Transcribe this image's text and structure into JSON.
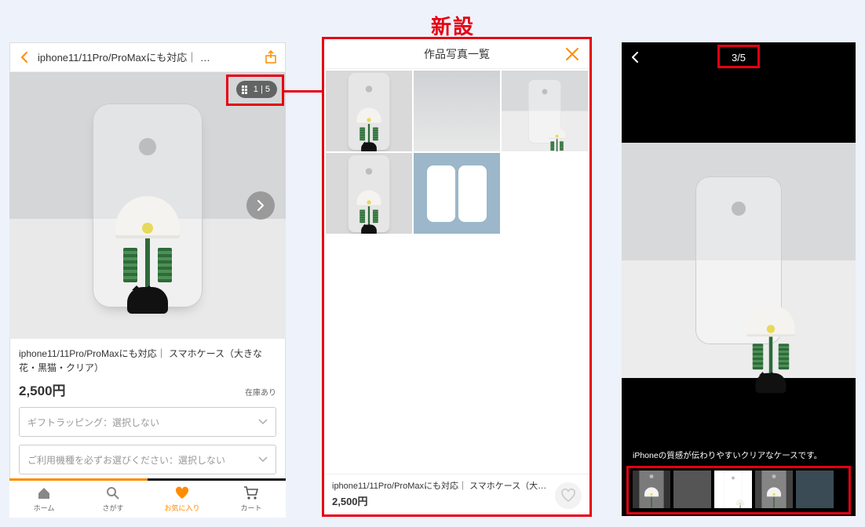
{
  "badge": "新設",
  "panel1": {
    "title": "iphone11/11Pro/ProMaxにも対応｜ …",
    "counter": "1 | 5",
    "product_name": "iphone11/11Pro/ProMaxにも対応｜ スマホケース（大きな花・黒猫・クリア）",
    "price": "2,500円",
    "stock": "在庫あり",
    "select1": "ギフトラッピング：選択しない",
    "select2": "ご利用機種を必ずお選びください：選択しない",
    "tabs": {
      "home": "ホーム",
      "search": "さがす",
      "fav": "お気に入り",
      "cart": "カート"
    }
  },
  "panel2": {
    "title": "作品写真一覧",
    "footer_name": "iphone11/11Pro/ProMaxにも対応｜ スマホケース（大…",
    "footer_price": "2,500円"
  },
  "panel3": {
    "counter": "3/5",
    "description": "iPhoneの質感が伝わりやすいクリアなケースです。"
  }
}
